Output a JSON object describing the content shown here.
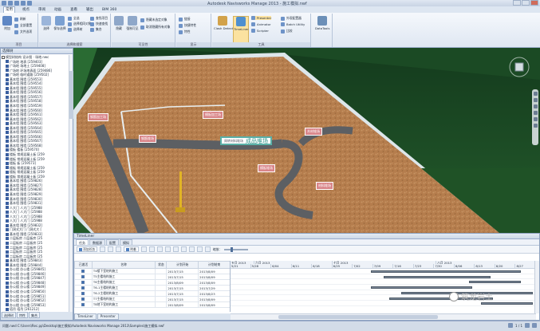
{
  "app": {
    "title": "Autodesk Navisworks Manage 2013 - 施工模拟.nwf"
  },
  "menu": [
    "常用",
    "视点",
    "审阅",
    "动画",
    "查看",
    "输出",
    "BIM 360"
  ],
  "ribbon": {
    "project_group": "项目",
    "select_group": "选择和搜索",
    "visibility_group": "可见性",
    "display_group": "显示",
    "tools_group": "工具",
    "append_label": "附加",
    "refresh_label": "刷新",
    "reset_label": "全部重置",
    "file_options_label": "文件选项",
    "select_label": "选择",
    "save_selection_label": "保存选择",
    "select_all_label": "全选",
    "select_same_label": "选择相同对象",
    "selection_tree_label": "选择树",
    "find_items_label": "查找项目",
    "quick_find_label": "快速查找",
    "sets_label": "集合",
    "hide_label": "隐藏",
    "require_label": "强制可见",
    "hide_unselected_label": "隐藏未选定对象",
    "unhide_all_label": "取消隐藏所有对象",
    "links_label": "链接",
    "quick_props_label": "快捷特性",
    "properties_label": "特性",
    "clash_label": "Clash Detective",
    "timeliner_label": "TimeLiner",
    "presenter_label": "Presenter",
    "animator_label": "Animator",
    "scripter_label": "Scripter",
    "appearance_label": "外观配置器",
    "batch_label": "Batch Utility",
    "compare_label": "比较",
    "datatools_label": "DataTools"
  },
  "selection_tree": {
    "title": "选择树",
    "items": [
      "模型树结构 设计图 · 场地.nwc",
      "广场地 地表 [259403]",
      "广场地 场地土 [259408]",
      "广场地 环场地表面 [259486]",
      "广场地 临时道路 [259502]",
      "基本墙 围墙 [259553]",
      "基本墙 围墙 [259554]",
      "基本墙 围墙 [259555]",
      "基本墙 围墙 [259556]",
      "基本墙 围墙 [259557]",
      "基本墙 围墙 [259558]",
      "基本墙 围墙 [259559]",
      "基本墙 围墙 [259560]",
      "基本墙 围墙 [259561]",
      "基本墙 围墙 [259562]",
      "基本墙 围墙 [259563]",
      "基本墙 围墙 [259564]",
      "基本墙 围墙 [259565]",
      "基本墙 围墙 [259566]",
      "基本墙 围墙 [259567]",
      "基本墙 围墙 [259568]",
      "楼板 楼板 [259570]",
      "楼板 常规混凝土板 [259",
      "楼板 常规混凝土板 [259",
      "楼板 板 [259573]",
      "楼板 常规混凝土板 [259",
      "楼板 常规混凝土板 [259",
      "楼板 常规混凝土板 [259",
      "基本墙 围墙 [259826]",
      "基本墙 围墙 [259827]",
      "基本墙 围墙 [259828]",
      "基本墙 围墙 [259829]",
      "基本墙 围墙 [259830]",
      "基本墙 围墙 [259831]",
      "人大门 人大门 [25988",
      "人大门 人大门 [25988",
      "人大门 人大门 [25988",
      "人大门 人大门 [25988",
      "基本墙 围墙 [259832]",
      "门洞式大门 门洞式大 [",
      "基本墙 围墙 [259833]",
      "二层板房 二层板房 [25",
      "二层板房 二层板房 [25",
      "二层板房 二层板房 [25",
      "二层板房 二层板房 [25",
      "二层板房 二层板房 [25",
      "基本墙 围墙 [259843]",
      "基本墙 围墙 [259844]",
      "办公楼 办公楼 [259845]",
      "办公楼 办公楼 [259846]",
      "办公楼 办公楼 [259847]",
      "办公楼 办公楼 [259848]",
      "办公楼 办公楼 [259849]",
      "办公楼 办公楼 [259850]",
      "办公楼 办公楼 [259851]",
      "办公楼 办公楼 [259852]",
      "办公楼 办公楼 [259853]",
      "塔吊 塔吊 [261212]"
    ]
  },
  "left_tabs": [
    "选择树",
    "特性",
    "集合"
  ],
  "scene": {
    "labels": [
      "钢筋加工场",
      "模板加工场",
      "钢筋堆场",
      "木材堆场",
      "成品堆场",
      "周转材料堆场",
      "模板堆场",
      "材料堆场"
    ],
    "sign_small": "周转材料堆场",
    "sign_large": "成品堆场"
  },
  "timeliner": {
    "title": "TimeLiner",
    "tabs": [
      "任务",
      "数据源",
      "配置",
      "模拟"
    ],
    "toolbar": {
      "add_task": "添加任务",
      "attach": "附着",
      "zoom_label": "缩放："
    },
    "columns": [
      "已激活",
      "名称",
      "状态",
      "计划开始",
      "计划结束"
    ],
    "tasks": [
      {
        "active": true,
        "name": "T4楼下室结构施工",
        "status": "",
        "start": "2013/7/15",
        "end": "2013/8/09"
      },
      {
        "active": true,
        "name": "T5主楼结构施工",
        "status": "",
        "start": "2013/7/15",
        "end": "2013/8/09"
      },
      {
        "active": true,
        "name": "T6主楼结构施工",
        "status": "",
        "start": "2013/8/09",
        "end": "2013/8/09"
      },
      {
        "active": true,
        "name": "T6-1主楼结构施工",
        "status": "",
        "start": "2013/7/15",
        "end": "2013/7/29"
      },
      {
        "active": true,
        "name": "T6-2主楼结构施工",
        "status": "",
        "start": "2013/7/15",
        "end": "2013/8/23"
      },
      {
        "active": true,
        "name": "T7主楼结构施工",
        "status": "",
        "start": "2013/7/15",
        "end": "2013/8/09"
      },
      {
        "active": true,
        "name": "T8地下室结构施工",
        "status": "",
        "start": "2013/8/09",
        "end": "2013/8/09"
      }
    ],
    "months": [
      "五月 2013",
      "六月 2013",
      "七月 2013",
      "八月 2013"
    ],
    "days": [
      "5/21",
      "5/28",
      "6/04",
      "6/11",
      "6/18",
      "6/25",
      "7/02",
      "7/09",
      "7/16",
      "7/23",
      "7/30",
      "8/06",
      "8/13",
      "8/20",
      "8/27"
    ],
    "bars": [
      {
        "start": 0.46,
        "end": 0.95
      },
      {
        "start": 0.5,
        "end": 0.85
      },
      {
        "start": 0.78,
        "end": 0.95
      },
      {
        "start": 0.46,
        "end": 0.79
      },
      {
        "start": 0.56,
        "end": 0.99
      },
      {
        "start": 0.52,
        "end": 0.86
      },
      {
        "start": 0.82,
        "end": 0.99
      }
    ],
    "bottom_tabs": [
      "TimeLiner",
      "Presenter"
    ]
  },
  "watermark": "筑龙岩土",
  "status": {
    "path": "问题.nwd C:\\Users\\Rec.pp\\Desktop\\施工模拟\\Autodesk Navisworks Manage 2013\\Samples\\施工模拟.nwf",
    "page": "1 / 1"
  }
}
